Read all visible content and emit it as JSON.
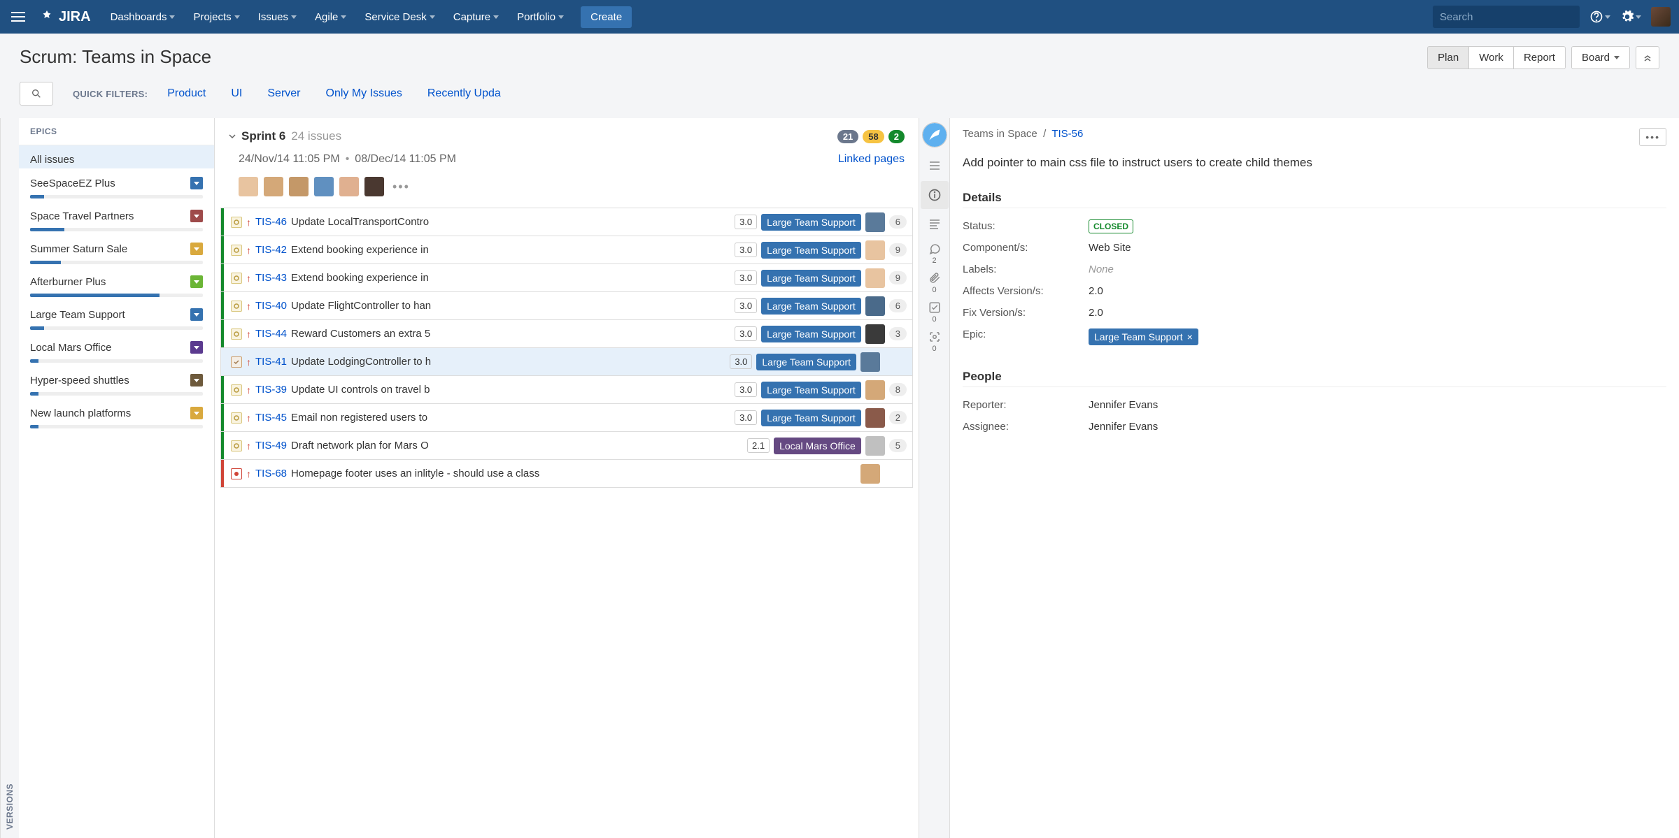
{
  "nav": {
    "logo": "JIRA",
    "items": [
      "Dashboards",
      "Projects",
      "Issues",
      "Agile",
      "Service Desk",
      "Capture",
      "Portfolio"
    ],
    "create": "Create",
    "search_placeholder": "Search"
  },
  "header": {
    "title": "Scrum: Teams in Space",
    "tabs": [
      "Plan",
      "Work",
      "Report"
    ],
    "active_tab": "Plan",
    "board_label": "Board"
  },
  "quick_filters": {
    "label": "QUICK FILTERS:",
    "items": [
      "Product",
      "UI",
      "Server",
      "Only My Issues",
      "Recently Upda"
    ]
  },
  "versions_tab": "VERSIONS",
  "epics": {
    "header": "EPICS",
    "all_issues": "All issues",
    "items": [
      {
        "name": "SeeSpaceEZ Plus",
        "color": "#3572b0",
        "progress": 8
      },
      {
        "name": "Space Travel Partners",
        "color": "#9e4a4a",
        "progress": 20
      },
      {
        "name": "Summer Saturn Sale",
        "color": "#d9a93e",
        "progress": 18
      },
      {
        "name": "Afterburner Plus",
        "color": "#6bb536",
        "progress": 75
      },
      {
        "name": "Large Team Support",
        "color": "#3572b0",
        "progress": 8
      },
      {
        "name": "Local Mars Office",
        "color": "#5b3a8f",
        "progress": 5
      },
      {
        "name": "Hyper-speed shuttles",
        "color": "#6e5a3c",
        "progress": 5
      },
      {
        "name": "New launch platforms",
        "color": "#d9a93e",
        "progress": 5
      }
    ]
  },
  "sprint": {
    "name": "Sprint 6",
    "count": "24 issues",
    "badges": {
      "todo": "21",
      "progress": "58",
      "done": "2"
    },
    "start": "24/Nov/14 11:05 PM",
    "end": "08/Dec/14 11:05 PM",
    "linked": "Linked pages",
    "avatar_count": 6,
    "issues": [
      {
        "bar": "#14892c",
        "type": "story",
        "key": "TIS-46",
        "summary": "Update LocalTransportContro",
        "version": "3.0",
        "epic": "Large Team Support",
        "est": "6"
      },
      {
        "bar": "#14892c",
        "type": "story",
        "key": "TIS-42",
        "summary": "Extend booking experience in",
        "version": "3.0",
        "epic": "Large Team Support",
        "est": "9"
      },
      {
        "bar": "#14892c",
        "type": "story",
        "key": "TIS-43",
        "summary": "Extend booking experience in",
        "version": "3.0",
        "epic": "Large Team Support",
        "est": "9"
      },
      {
        "bar": "#14892c",
        "type": "story",
        "key": "TIS-40",
        "summary": "Update FlightController to han",
        "version": "3.0",
        "epic": "Large Team Support",
        "est": "6"
      },
      {
        "bar": "#14892c",
        "type": "story",
        "key": "TIS-44",
        "summary": "Reward Customers an extra 5",
        "version": "3.0",
        "epic": "Large Team Support",
        "est": "3"
      },
      {
        "bar": "#e6f0fa",
        "type": "task",
        "key": "TIS-41",
        "summary": "Update LodgingController to h",
        "version": "3.0",
        "epic": "Large Team Support",
        "est": "",
        "selected": true
      },
      {
        "bar": "#14892c",
        "type": "story",
        "key": "TIS-39",
        "summary": "Update UI controls on travel b",
        "version": "3.0",
        "epic": "Large Team Support",
        "est": "8"
      },
      {
        "bar": "#14892c",
        "type": "story",
        "key": "TIS-45",
        "summary": "Email non registered users to",
        "version": "3.0",
        "epic": "Large Team Support",
        "est": "2"
      },
      {
        "bar": "#14892c",
        "type": "story",
        "key": "TIS-49",
        "summary": "Draft network plan for Mars O",
        "version": "2.1",
        "epic": "Local Mars Office",
        "epicColor": "purple",
        "est": "5"
      },
      {
        "bar": "#d04437",
        "type": "bug",
        "key": "TIS-68",
        "summary": "Homepage footer uses an inlityle - should use a class",
        "version": "",
        "epic": "",
        "est": ""
      }
    ]
  },
  "detail": {
    "project": "Teams in Space",
    "key": "TIS-56",
    "summary": "Add pointer to main css file to instruct users to create child themes",
    "sections": {
      "details": "Details",
      "people": "People"
    },
    "fields": {
      "status_label": "Status:",
      "status_value": "CLOSED",
      "components_label": "Component/s:",
      "components_value": "Web Site",
      "labels_label": "Labels:",
      "labels_value": "None",
      "affects_label": "Affects Version/s:",
      "affects_value": "2.0",
      "fix_label": "Fix Version/s:",
      "fix_value": "2.0",
      "epic_label": "Epic:",
      "epic_value": "Large Team Support",
      "reporter_label": "Reporter:",
      "reporter_value": "Jennifer Evans",
      "assignee_label": "Assignee:",
      "assignee_value": "Jennifer Evans"
    },
    "rail_counts": {
      "comments": "2",
      "attachments": "0",
      "subtasks": "0",
      "screenshots": "0"
    }
  }
}
